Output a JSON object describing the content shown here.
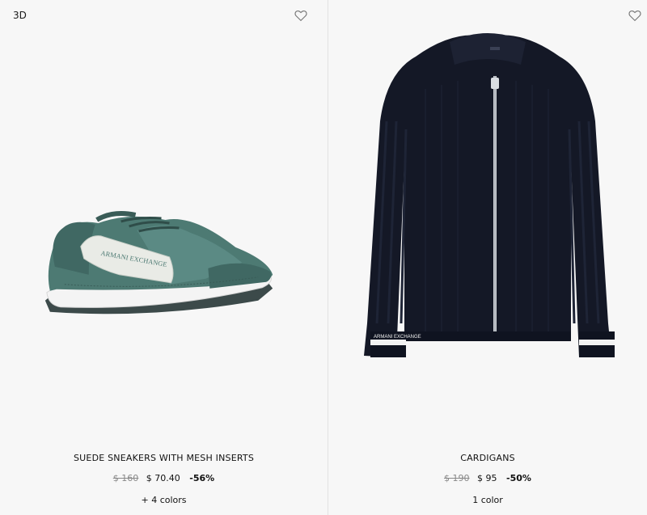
{
  "products": [
    {
      "badge": "3D",
      "name": "SUEDE SNEAKERS WITH MESH INSERTS",
      "old_price": "$ 160",
      "new_price": "$ 70.40",
      "discount": "-56%",
      "colors": "+ 4 colors",
      "image_icon": "sneaker-image",
      "logo_text": "ARMANI EXCHANGE"
    },
    {
      "name": "CARDIGANS",
      "old_price": "$ 190",
      "new_price": "$ 95",
      "discount": "-50%",
      "colors": "1 color",
      "image_icon": "cardigan-image",
      "cuff_text": "ARMANI EXCHANGE"
    }
  ],
  "colors": {
    "card_bg": "#f7f7f7",
    "sneaker_teal": "#4d7a73",
    "cardigan_navy": "#141826"
  }
}
